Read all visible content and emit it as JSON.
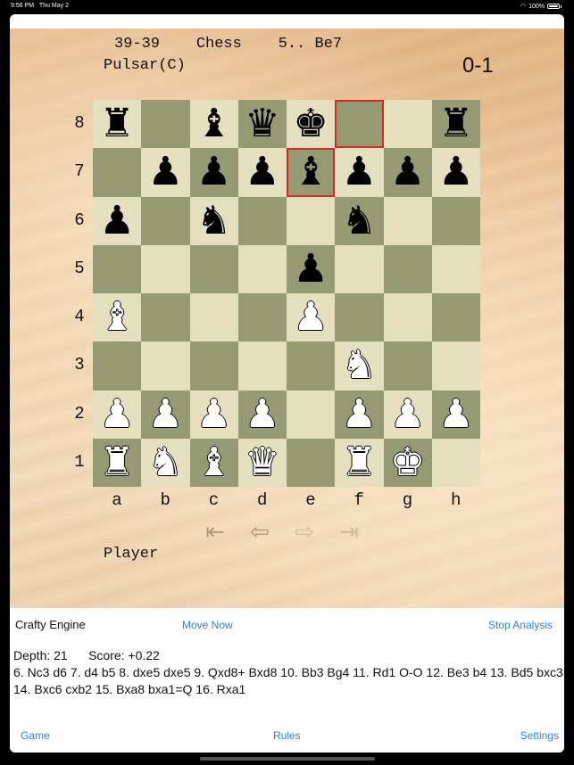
{
  "status_bar": {
    "time": "9:56 PM",
    "date": "Thu May 2",
    "battery": "100%"
  },
  "header": {
    "clock": "39-39",
    "variant": "Chess",
    "last_move": "5.. Be7",
    "opponent": "Pulsar(C)",
    "score": "0-1"
  },
  "board": {
    "ranks": [
      "8",
      "7",
      "6",
      "5",
      "4",
      "3",
      "2",
      "1"
    ],
    "files": [
      "a",
      "b",
      "c",
      "d",
      "e",
      "f",
      "g",
      "h"
    ],
    "highlighted": [
      "f8",
      "e7"
    ],
    "position": [
      [
        "r",
        "",
        "b",
        "q",
        "k",
        "",
        "",
        "r"
      ],
      [
        "",
        "p",
        "p",
        "p",
        "b",
        "p",
        "p",
        "p"
      ],
      [
        "p",
        "",
        "n",
        "",
        "",
        "n",
        "",
        ""
      ],
      [
        "",
        "",
        "",
        "",
        "p",
        "",
        "",
        ""
      ],
      [
        "B",
        "",
        "",
        "",
        "P",
        "",
        "",
        ""
      ],
      [
        "",
        "",
        "",
        "",
        "",
        "N",
        "",
        ""
      ],
      [
        "P",
        "P",
        "P",
        "P",
        "",
        "P",
        "P",
        "P"
      ],
      [
        "R",
        "N",
        "B",
        "Q",
        "",
        "R",
        "K",
        ""
      ]
    ]
  },
  "nav": {
    "first": "first-move-arrow",
    "back": "back-arrow",
    "forward": "forward-arrow",
    "last": "last-move-arrow"
  },
  "player_label": "Player",
  "engine": {
    "title": "Crafty Engine",
    "move_now": "Move Now",
    "stop": "Stop Analysis",
    "depth": "Depth: 21",
    "score": "Score: +0.22",
    "pv": "6. Nc3 d6 7. d4 b5 8. dxe5 dxe5 9. Qxd8+ Bxd8 10. Bb3 Bg4 11. Rd1 O-O 12. Be3 b4 13. Bd5 bxc3 14. Bxc6 cxb2 15. Bxa8 bxa1=Q 16. Rxa1"
  },
  "toolbar": {
    "game": "Game",
    "rules": "Rules",
    "settings": "Settings"
  },
  "colors": {
    "accent": "#2f7ee0",
    "light_square": "#e4e0bf",
    "dark_square": "#959a72",
    "highlight": "#d22b24"
  }
}
